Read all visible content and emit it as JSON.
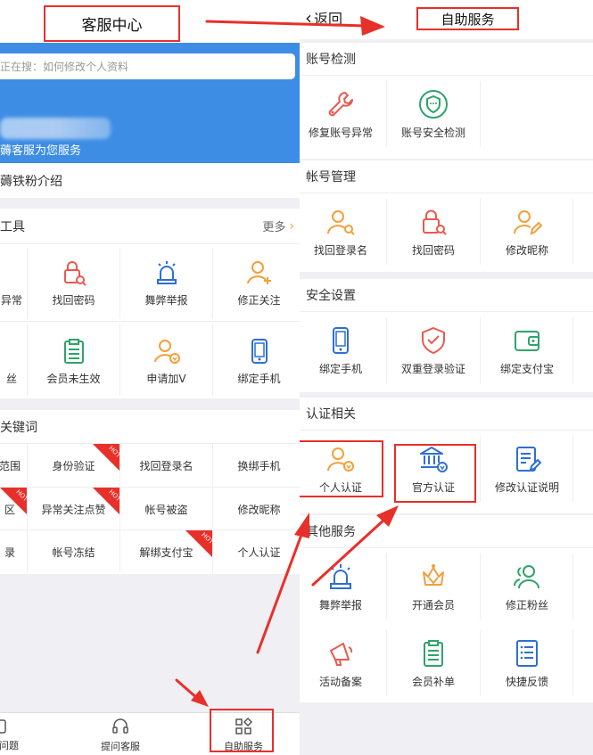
{
  "left": {
    "title": "客服中心",
    "search_placeholder": "正在搜：如何修改个人资料",
    "banner_sub": "薅客服为您服务",
    "intro": "薅铁粉介绍",
    "tools": {
      "heading": "工具",
      "more": "更多",
      "items": [
        "异常",
        "找回密码",
        "舞弊举报",
        "修正关注",
        "丝",
        "会员未生效",
        "申请加V",
        "绑定手机"
      ]
    },
    "keywords": {
      "heading": "关键词",
      "items": [
        "范围",
        "身份验证",
        "找回登录名",
        "换绑手机",
        "区",
        "异常关注点赞",
        "帐号被盗",
        "修改昵称",
        "录",
        "帐号冻结",
        "解绑支付宝",
        "个人认证"
      ],
      "hot_label": "HOT"
    },
    "bottom": [
      "问题",
      "提问客服",
      "自助服务"
    ]
  },
  "right": {
    "back": "返回",
    "title": "自助服务",
    "sections": [
      {
        "title": "账号检测",
        "items": [
          "修复账号异常",
          "账号安全检测"
        ]
      },
      {
        "title": "帐号管理",
        "items": [
          "找回登录名",
          "找回密码",
          "修改昵称"
        ]
      },
      {
        "title": "安全设置",
        "items": [
          "绑定手机",
          "双重登录验证",
          "绑定支付宝"
        ]
      },
      {
        "title": "认证相关",
        "items": [
          "个人认证",
          "官方认证",
          "修改认证说明"
        ]
      },
      {
        "title": "其他服务",
        "items": [
          "舞弊举报",
          "开通会员",
          "修正粉丝",
          "活动备案",
          "会员补单",
          "快捷反馈"
        ]
      }
    ]
  },
  "colors": {
    "accent_blue": "#3d8de4",
    "highlight_red": "#e8302a",
    "icon_orange": "#f2a03a",
    "icon_red": "#e85a4f",
    "icon_green": "#2fa36b",
    "icon_blue": "#2f6fd0"
  }
}
